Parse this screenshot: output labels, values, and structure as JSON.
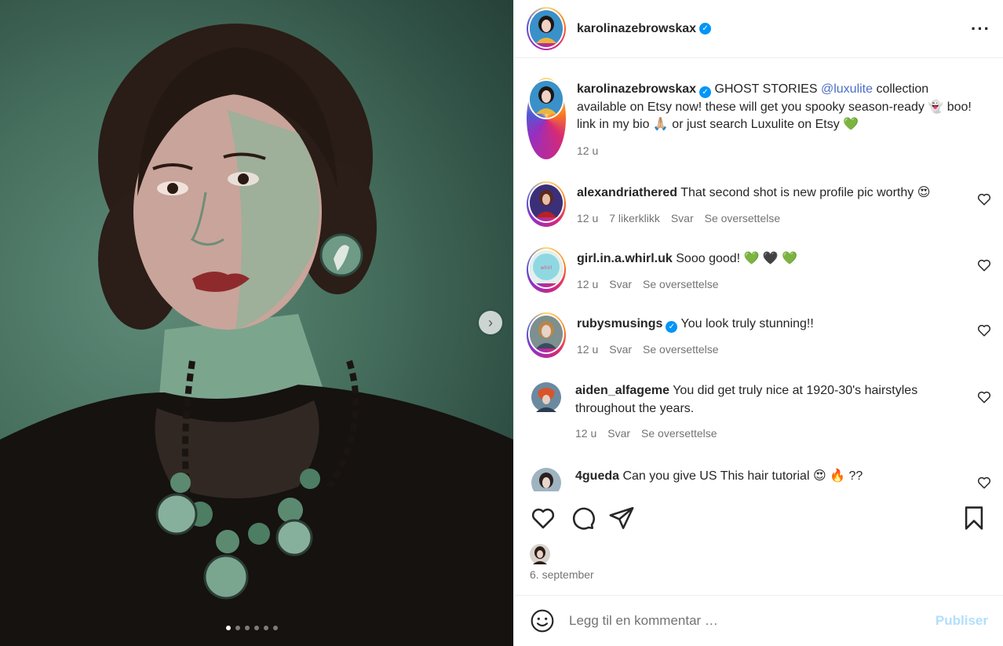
{
  "post": {
    "username": "karolinazebrowskax",
    "more_icon": "more-horizontal-icon",
    "caption_prefix": "GHOST STORIES ",
    "caption_mention": "@luxulite",
    "caption_text": " collection available on Etsy now! these will get you spooky season-ready 👻 boo! link in my bio 🙏🏼 or just search Luxulite on Etsy 💚",
    "caption_time": "12 u",
    "date": "6. september"
  },
  "comments": [
    {
      "user": "alexandriathered",
      "verified": false,
      "text": "That second shot is new profile pic worthy 😍",
      "time": "12 u",
      "likes": "7 likerklikk",
      "reply": "Svar",
      "translate": "Se oversettelse"
    },
    {
      "user": "girl.in.a.whirl.uk",
      "verified": false,
      "text": "Sooo good! 💚 🖤 💚",
      "time": "12 u",
      "reply": "Svar",
      "translate": "Se oversettelse"
    },
    {
      "user": "rubysmusings",
      "verified": true,
      "text": "You look truly stunning!!",
      "time": "12 u",
      "reply": "Svar",
      "translate": "Se oversettelse"
    },
    {
      "user": "aiden_alfageme",
      "verified": false,
      "text": "You did get truly nice at 1920-30's hairstyles throughout the years.",
      "time": "12 u",
      "reply": "Svar",
      "translate": "Se oversettelse"
    },
    {
      "user": "4gueda",
      "verified": false,
      "text": "Can you give US This hair tutorial 😍 🔥 ??"
    }
  ],
  "add_comment": {
    "placeholder": "Legg til en kommentar …",
    "publish_label": "Publiser"
  },
  "carousel": {
    "total": 6,
    "active": 1
  },
  "colors": {
    "accent": "#0095f6",
    "muted": "#737373",
    "publish": "#b2dffc",
    "photo_bg": "#47705f"
  }
}
